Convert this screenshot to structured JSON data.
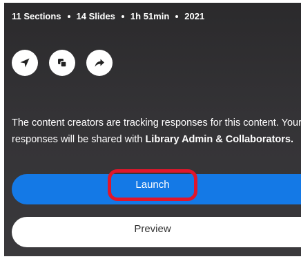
{
  "meta": {
    "sections": "11 Sections",
    "slides": "14 Slides",
    "duration": "1h 51min",
    "year": "2021"
  },
  "actions": {
    "icons": [
      "navigate-arrow-icon",
      "copy-icon",
      "share-icon"
    ]
  },
  "notice": {
    "line_prefix": "The content creators are tracking responses for this content. Your responses will be shared with ",
    "emphasis": "Library Admin & Collaborators."
  },
  "buttons": {
    "launch_label": "Launch",
    "preview_label": "Preview"
  },
  "colors": {
    "accent": "#1479e6",
    "highlight": "#e0162b",
    "panel_bg": "#2b2a2c"
  }
}
